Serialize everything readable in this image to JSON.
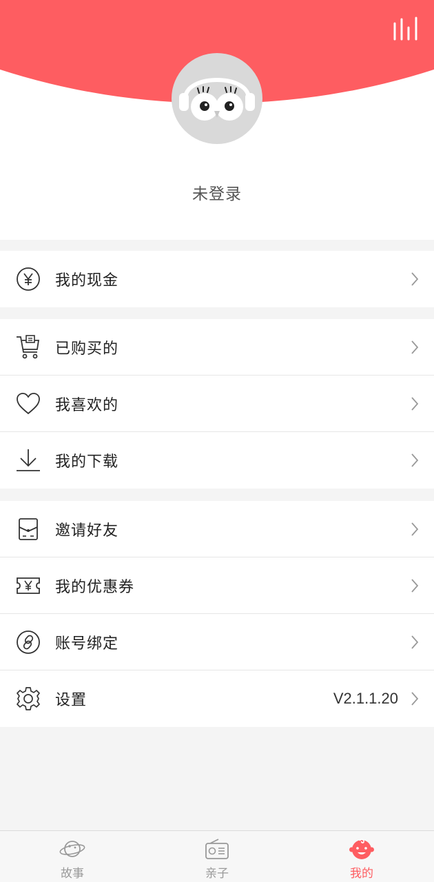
{
  "profile": {
    "login_status": "未登录"
  },
  "menu": {
    "cash": {
      "label": "我的现金",
      "icon": "yen-circle-icon"
    },
    "purchased": {
      "label": "已购买的",
      "icon": "cart-icon"
    },
    "liked": {
      "label": "我喜欢的",
      "icon": "heart-icon"
    },
    "downloads": {
      "label": "我的下载",
      "icon": "download-icon"
    },
    "invite": {
      "label": "邀请好友",
      "icon": "envelope-icon"
    },
    "coupons": {
      "label": "我的优惠券",
      "icon": "coupon-icon"
    },
    "account_binding": {
      "label": "账号绑定",
      "icon": "link-icon"
    },
    "settings": {
      "label": "设置",
      "icon": "gear-icon",
      "version": "V2.1.1.20"
    }
  },
  "tabbar": {
    "tabs": [
      {
        "label": "故事",
        "icon": "planet-icon",
        "active": false
      },
      {
        "label": "亲子",
        "icon": "radio-icon",
        "active": false
      },
      {
        "label": "我的",
        "icon": "baby-face-icon",
        "active": true
      }
    ]
  },
  "colors": {
    "accent": "#fe5d61",
    "background": "#f4f4f4",
    "avatar_bg": "#d9d9d9"
  }
}
